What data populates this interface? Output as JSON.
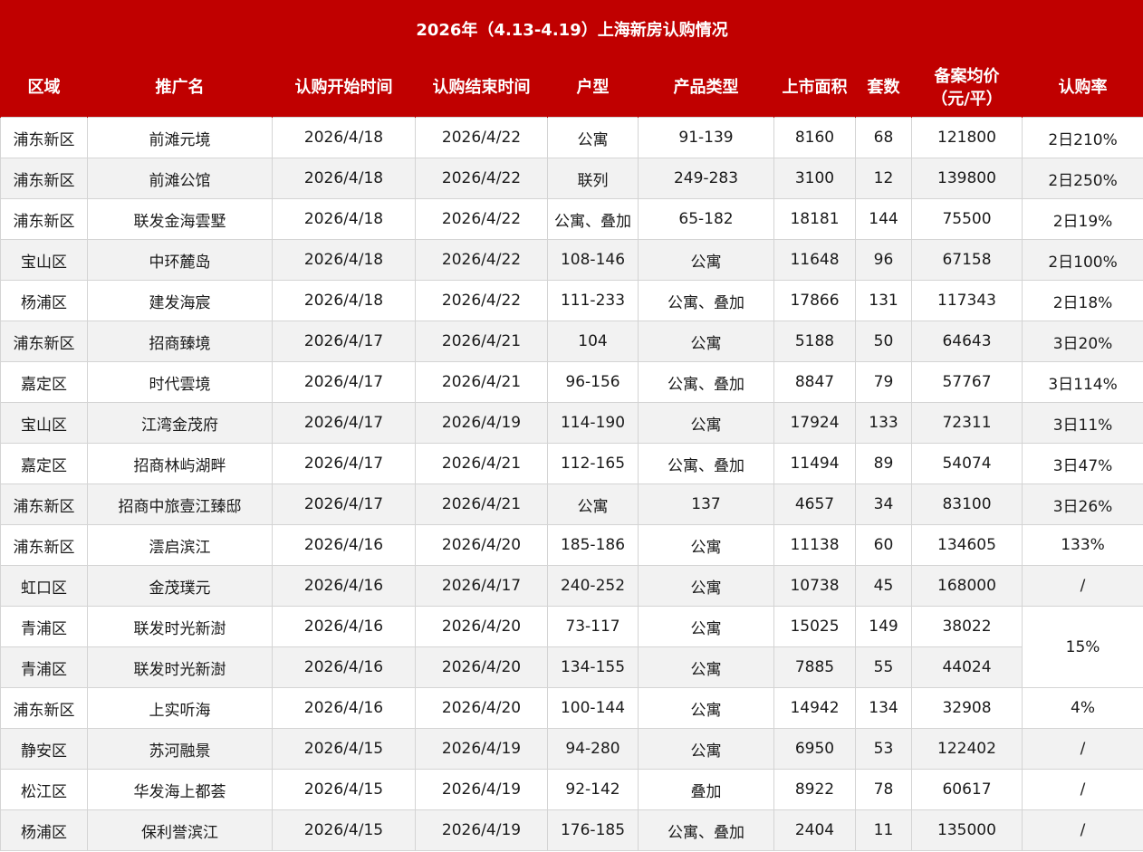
{
  "title": "2026年（4.13-4.19）上海新房认购情况",
  "headers": [
    {
      "line1": "区域",
      "line2": ""
    },
    {
      "line1": "推广名",
      "line2": ""
    },
    {
      "line1": "认购开始时间",
      "line2": ""
    },
    {
      "line1": "认购结束时间",
      "line2": ""
    },
    {
      "line1": "户型",
      "line2": ""
    },
    {
      "line1": "产品类型",
      "line2": ""
    },
    {
      "line1": "上市面积",
      "line2": ""
    },
    {
      "line1": "套数",
      "line2": ""
    },
    {
      "line1": "备案均价",
      "line2": "（元/平）"
    },
    {
      "line1": "认购率",
      "line2": ""
    }
  ],
  "rows": [
    {
      "district": "浦东新区",
      "name": "前滩元境",
      "start": "2026/4/18",
      "end": "2026/4/22",
      "unit": "公寓",
      "ptype": "91-139",
      "area": "8160",
      "count": "68",
      "price": "121800",
      "rate": "2日210%"
    },
    {
      "district": "浦东新区",
      "name": "前滩公馆",
      "start": "2026/4/18",
      "end": "2026/4/22",
      "unit": "联列",
      "ptype": "249-283",
      "area": "3100",
      "count": "12",
      "price": "139800",
      "rate": "2日250%"
    },
    {
      "district": "浦东新区",
      "name": "联发金海雲墅",
      "start": "2026/4/18",
      "end": "2026/4/22",
      "unit": "公寓、叠加",
      "ptype": "65-182",
      "area": "18181",
      "count": "144",
      "price": "75500",
      "rate": "2日19%"
    },
    {
      "district": "宝山区",
      "name": "中环麓岛",
      "start": "2026/4/18",
      "end": "2026/4/22",
      "unit": "108-146",
      "ptype": "公寓",
      "area": "11648",
      "count": "96",
      "price": "67158",
      "rate": "2日100%"
    },
    {
      "district": "杨浦区",
      "name": "建发海宸",
      "start": "2026/4/18",
      "end": "2026/4/22",
      "unit": "111-233",
      "ptype": "公寓、叠加",
      "area": "17866",
      "count": "131",
      "price": "117343",
      "rate": "2日18%"
    },
    {
      "district": "浦东新区",
      "name": "招商臻境",
      "start": "2026/4/17",
      "end": "2026/4/21",
      "unit": "104",
      "ptype": "公寓",
      "area": "5188",
      "count": "50",
      "price": "64643",
      "rate": "3日20%"
    },
    {
      "district": "嘉定区",
      "name": "时代雲境",
      "start": "2026/4/17",
      "end": "2026/4/21",
      "unit": "96-156",
      "ptype": "公寓、叠加",
      "area": "8847",
      "count": "79",
      "price": "57767",
      "rate": "3日114%"
    },
    {
      "district": "宝山区",
      "name": "江湾金茂府",
      "start": "2026/4/17",
      "end": "2026/4/19",
      "unit": "114-190",
      "ptype": "公寓",
      "area": "17924",
      "count": "133",
      "price": "72311",
      "rate": "3日11%"
    },
    {
      "district": "嘉定区",
      "name": "招商林屿湖畔",
      "start": "2026/4/17",
      "end": "2026/4/21",
      "unit": "112-165",
      "ptype": "公寓、叠加",
      "area": "11494",
      "count": "89",
      "price": "54074",
      "rate": "3日47%"
    },
    {
      "district": "浦东新区",
      "name": "招商中旅壹江臻邸",
      "start": "2026/4/17",
      "end": "2026/4/21",
      "unit": "公寓",
      "ptype": "137",
      "area": "4657",
      "count": "34",
      "price": "83100",
      "rate": "3日26%"
    },
    {
      "district": "浦东新区",
      "name": "澐启滨江",
      "start": "2026/4/16",
      "end": "2026/4/20",
      "unit": "185-186",
      "ptype": "公寓",
      "area": "11138",
      "count": "60",
      "price": "134605",
      "rate": "133%"
    },
    {
      "district": "虹口区",
      "name": "金茂璞元",
      "start": "2026/4/16",
      "end": "2026/4/17",
      "unit": "240-252",
      "ptype": "公寓",
      "area": "10738",
      "count": "45",
      "price": "168000",
      "rate": "/"
    },
    {
      "district": "青浦区",
      "name": "联发时光新澍",
      "start": "2026/4/16",
      "end": "2026/4/20",
      "unit": "73-117",
      "ptype": "公寓",
      "area": "15025",
      "count": "149",
      "price": "38022",
      "rate": "15%"
    },
    {
      "district": "青浦区",
      "name": "联发时光新澍",
      "start": "2026/4/16",
      "end": "2026/4/20",
      "unit": "134-155",
      "ptype": "公寓",
      "area": "7885",
      "count": "55",
      "price": "44024",
      "rate": ""
    },
    {
      "district": "浦东新区",
      "name": "上实听海",
      "start": "2026/4/16",
      "end": "2026/4/20",
      "unit": "100-144",
      "ptype": "公寓",
      "area": "14942",
      "count": "134",
      "price": "32908",
      "rate": "4%"
    },
    {
      "district": "静安区",
      "name": "苏河融景",
      "start": "2026/4/15",
      "end": "2026/4/19",
      "unit": "94-280",
      "ptype": "公寓",
      "area": "6950",
      "count": "53",
      "price": "122402",
      "rate": "/"
    },
    {
      "district": "松江区",
      "name": "华发海上都荟",
      "start": "2026/4/15",
      "end": "2026/4/19",
      "unit": "92-142",
      "ptype": "叠加",
      "area": "8922",
      "count": "78",
      "price": "60617",
      "rate": "/"
    },
    {
      "district": "杨浦区",
      "name": "保利誉滨江",
      "start": "2026/4/15",
      "end": "2026/4/19",
      "unit": "176-185",
      "ptype": "公寓、叠加",
      "area": "2404",
      "count": "11",
      "price": "135000",
      "rate": "/"
    }
  ]
}
